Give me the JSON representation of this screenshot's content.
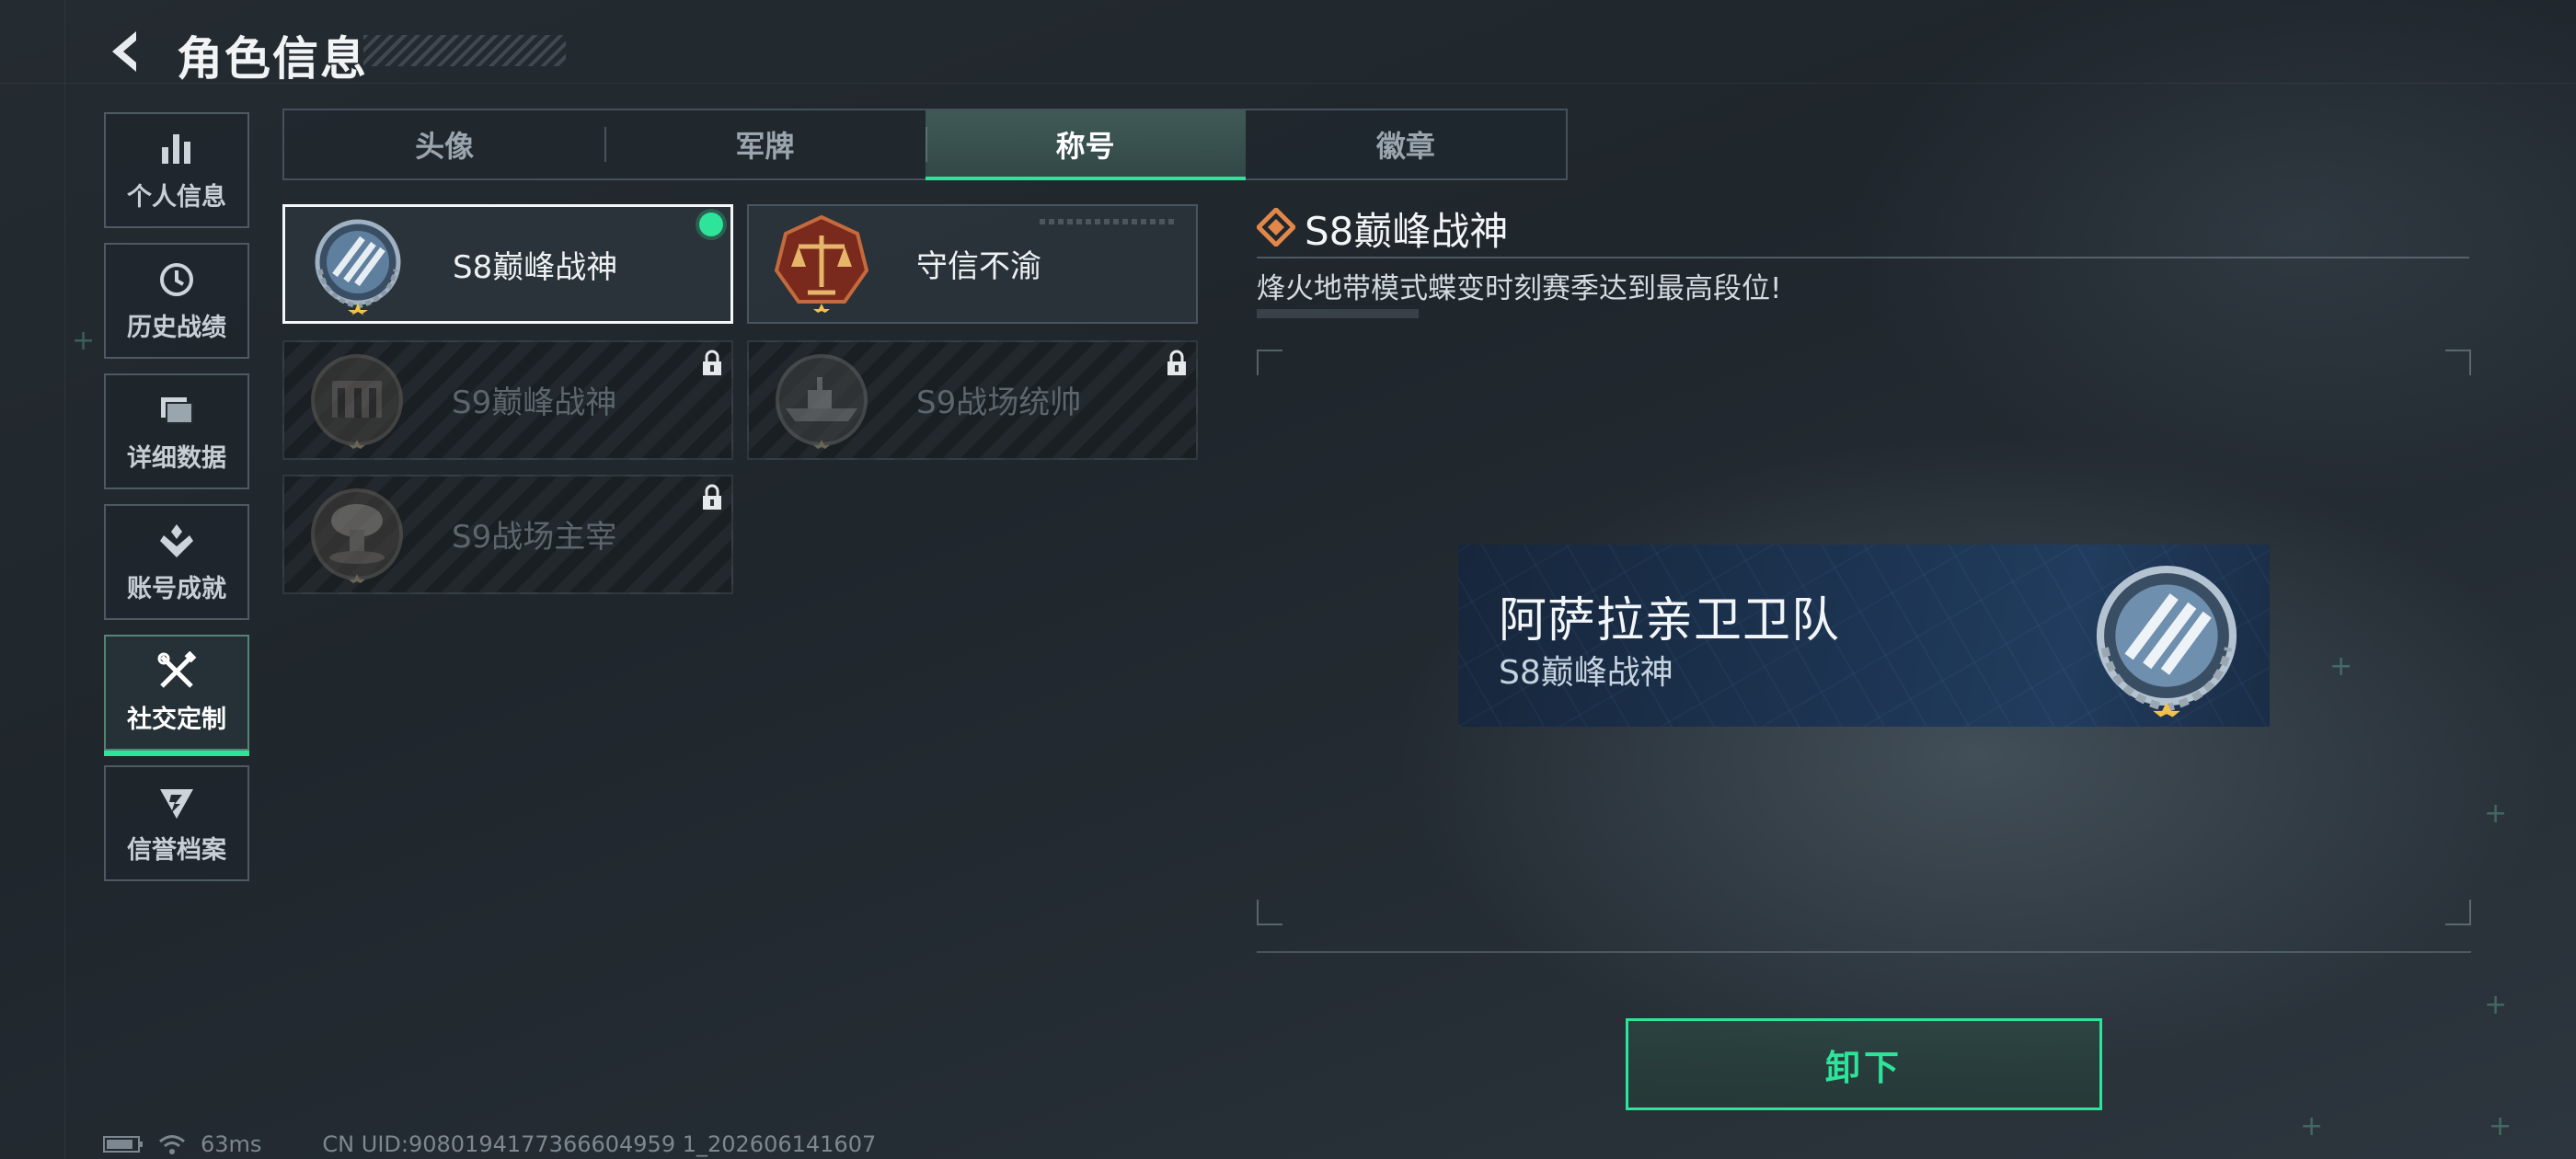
{
  "header": {
    "title": "角色信息"
  },
  "sidebar": {
    "items": [
      {
        "label": "个人信息",
        "icon": "bar-chart-icon"
      },
      {
        "label": "历史战绩",
        "icon": "clock-icon"
      },
      {
        "label": "详细数据",
        "icon": "folder-icon"
      },
      {
        "label": "账号成就",
        "icon": "achievement-icon"
      },
      {
        "label": "社交定制",
        "icon": "tools-icon",
        "active": true
      },
      {
        "label": "信誉档案",
        "icon": "shield-icon"
      }
    ]
  },
  "tabs": [
    {
      "label": "头像"
    },
    {
      "label": "军牌"
    },
    {
      "label": "称号",
      "active": true
    },
    {
      "label": "徽章"
    }
  ],
  "titles": [
    {
      "label": "S8巅峰战神",
      "emblem": "laurel-stripes-emblem-icon",
      "selected": true,
      "equipped": true,
      "locked": false
    },
    {
      "label": "守信不渝",
      "emblem": "scales-emblem-icon",
      "selected": false,
      "equipped": false,
      "locked": false
    },
    {
      "label": "S9巅峰战神",
      "emblem": "fortress-emblem-icon",
      "locked": true
    },
    {
      "label": "S9战场统帅",
      "emblem": "warship-emblem-icon",
      "locked": true
    },
    {
      "label": "S9战场主宰",
      "emblem": "mushroom-cloud-emblem-icon",
      "locked": true
    }
  ],
  "detail": {
    "title": "S8巅峰战神",
    "description": "烽火地带模式蝶变时刻赛季达到最高段位!"
  },
  "nameplate": {
    "name": "阿萨拉亲卫卫队",
    "title": "S8巅峰战神"
  },
  "actions": {
    "unequip_label": "卸下"
  },
  "status": {
    "ping": "63ms",
    "uid": "CN UID:9080194177366604959 1_202606141607"
  },
  "colors": {
    "accent": "#2ee39a",
    "background": "#232a30",
    "nameplate": "#1c3350"
  }
}
